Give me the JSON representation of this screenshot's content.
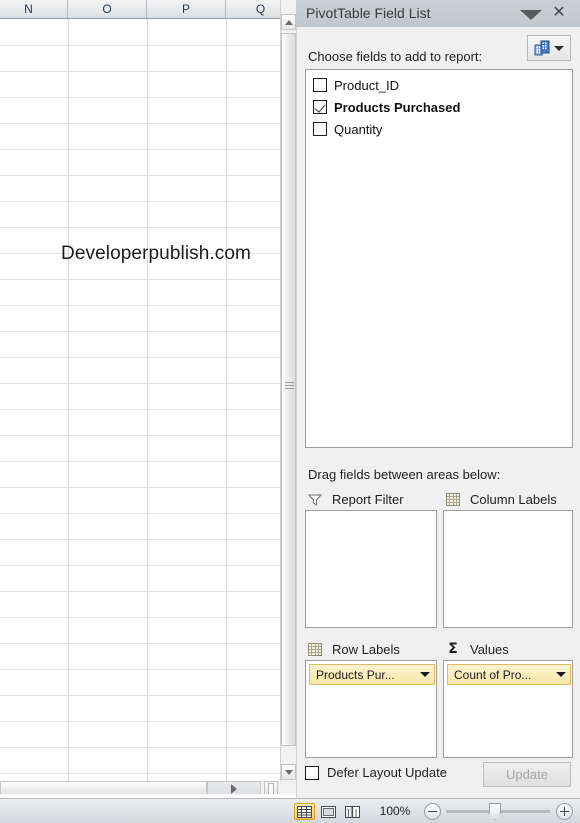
{
  "spreadsheet": {
    "column_headers": [
      "N",
      "O",
      "P",
      "Q"
    ],
    "watermark": "Developerpublish.com"
  },
  "panel": {
    "title": "PivotTable Field List",
    "menu_icon": "chevron-down-icon",
    "close_icon": "close-icon",
    "choose_label": "Choose fields to add to report:",
    "layout_button_icon": "fields-section-layout-icon",
    "layout_button_arrow": "chevron-down-icon",
    "fields": [
      {
        "label": "Product_ID",
        "checked": false
      },
      {
        "label": "Products Purchased",
        "checked": true
      },
      {
        "label": "Quantity",
        "checked": false
      }
    ],
    "drag_label": "Drag fields between areas below:",
    "areas": [
      {
        "name": "report-filter",
        "title": "Report Filter",
        "icon": "funnel-icon",
        "chips": []
      },
      {
        "name": "column-labels",
        "title": "Column Labels",
        "icon": "grid-icon",
        "chips": []
      },
      {
        "name": "row-labels",
        "title": "Row Labels",
        "icon": "grid-icon",
        "chips": [
          "Products Pur..."
        ]
      },
      {
        "name": "values",
        "title": "Values",
        "icon": "sigma-icon",
        "chips": [
          "Count of Pro..."
        ]
      }
    ],
    "defer_label": "Defer Layout Update",
    "defer_checked": false,
    "update_label": "Update",
    "update_disabled": true
  },
  "statusbar": {
    "views": [
      {
        "name": "normal",
        "icon": "normal-view-icon",
        "active": true
      },
      {
        "name": "page-layout",
        "icon": "page-layout-view-icon",
        "active": false
      },
      {
        "name": "page-break-preview",
        "icon": "page-break-preview-icon",
        "active": false
      }
    ],
    "zoom_level": "100%",
    "zoom_out_icon": "minus-icon",
    "zoom_in_icon": "plus-icon"
  },
  "colors": {
    "panel_title_bg": "#c6cbd0",
    "panel_bg": "#f0f0f0",
    "chip_bg": "#f8e7a8",
    "chip_border": "#d9bd62",
    "accent_active": "#f6cf64"
  }
}
